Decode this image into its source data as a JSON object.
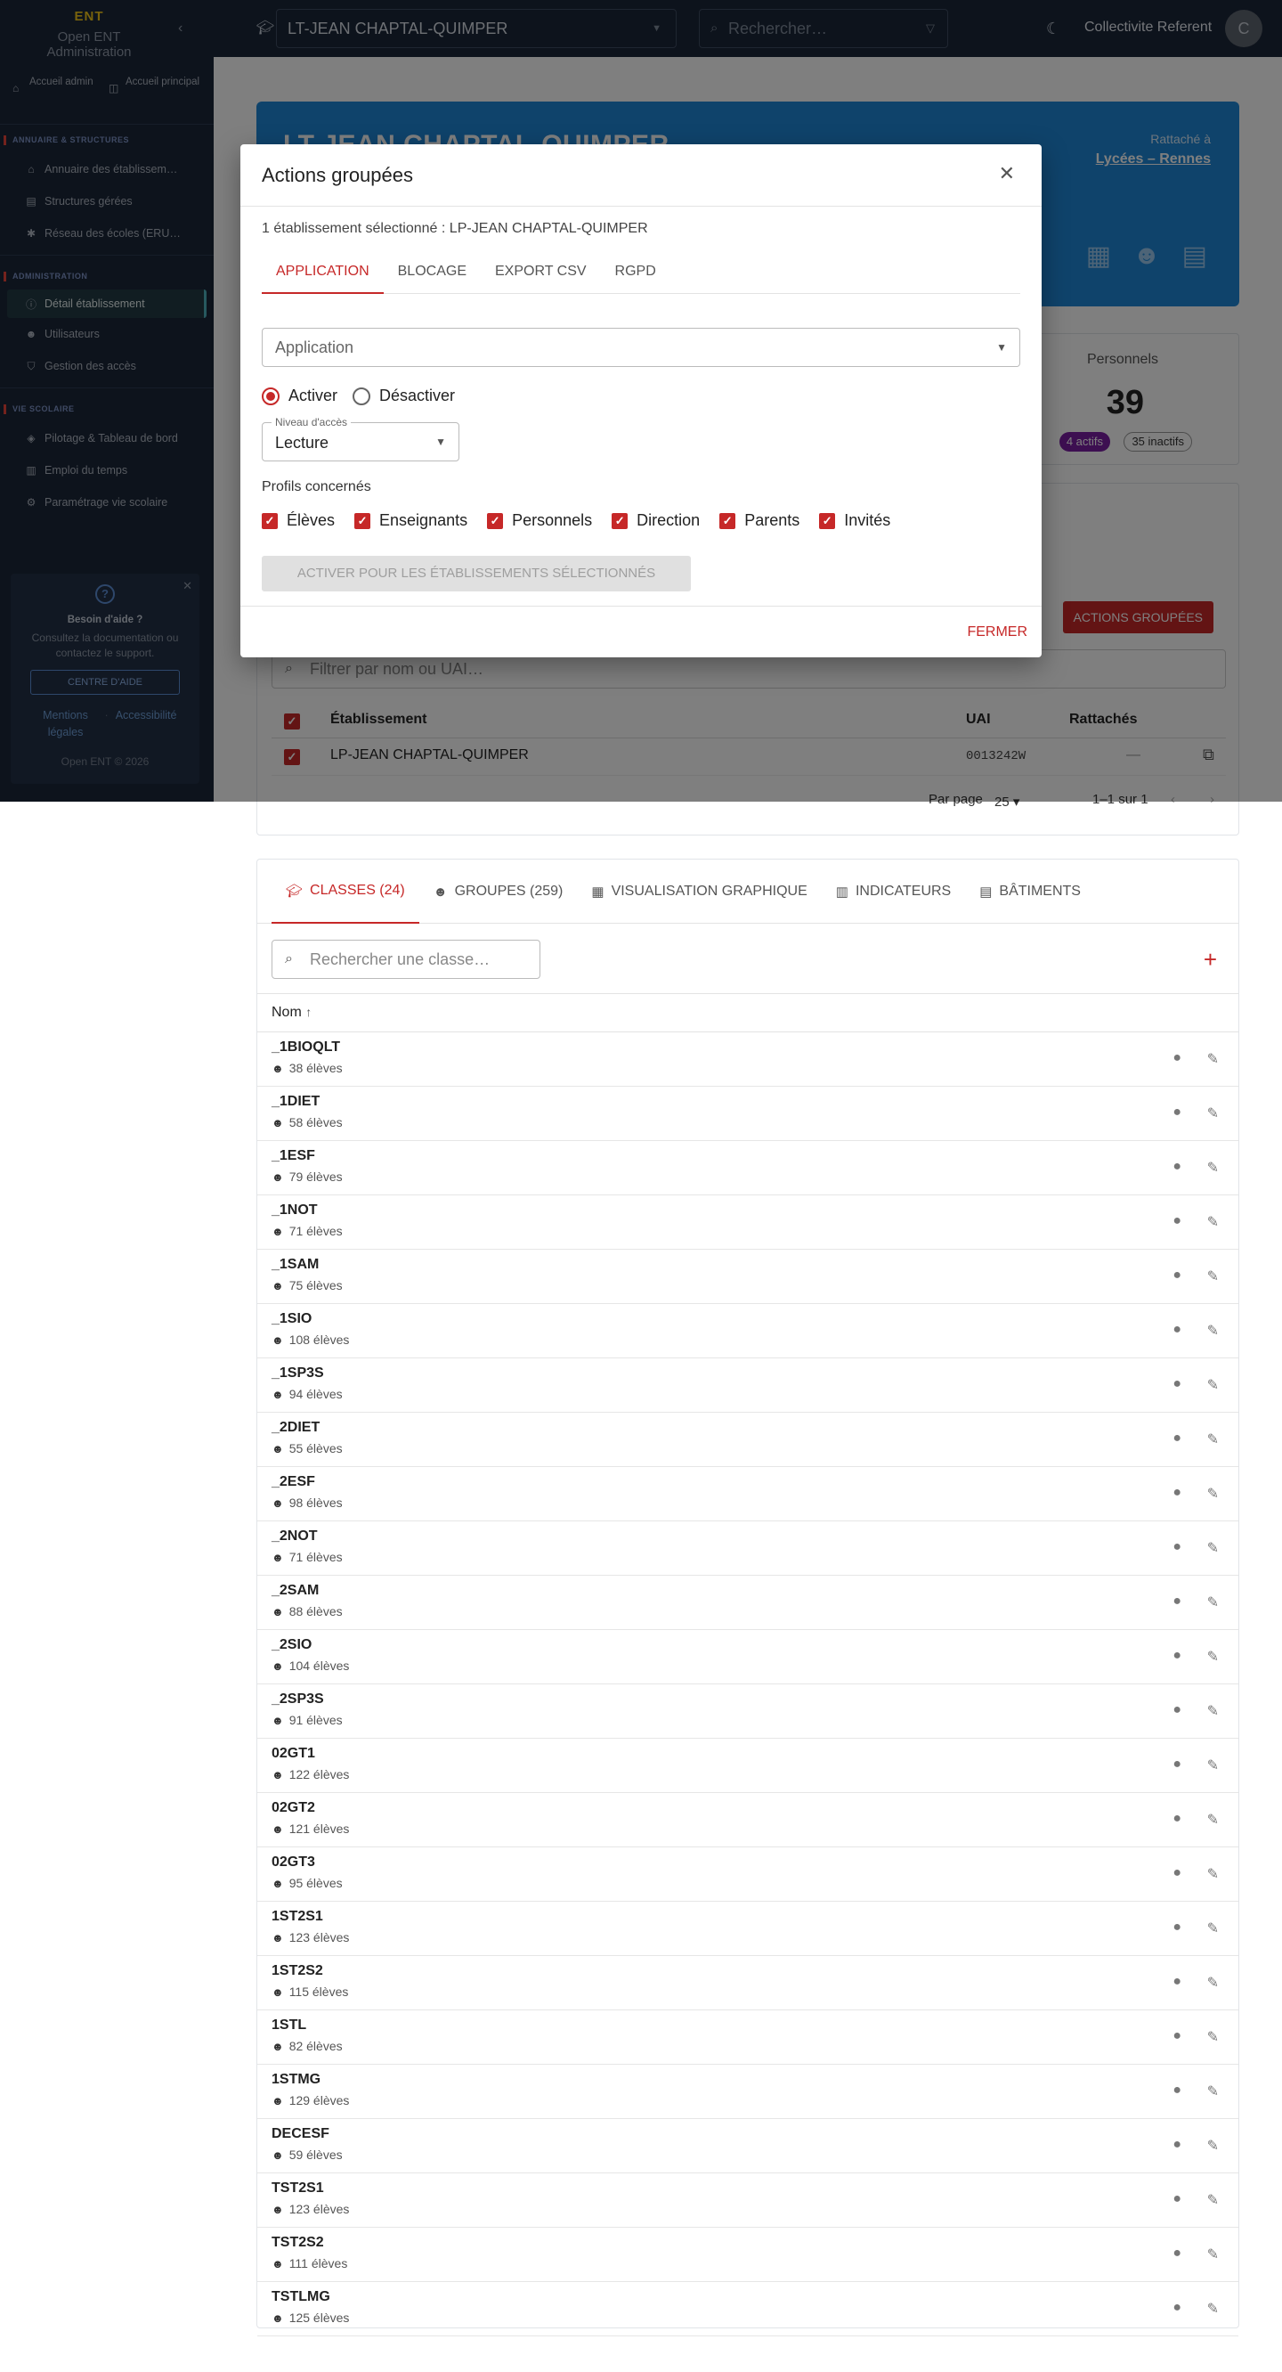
{
  "app": {
    "logo": "ENT",
    "name": "Open ENT Administration"
  },
  "sidebar": {
    "home": [
      {
        "label": "Accueil admin",
        "icon": "home-icon"
      },
      {
        "label": "Accueil principal",
        "icon": "external-link-icon"
      }
    ],
    "sections": [
      {
        "title": "Annuaire & structures",
        "items": [
          {
            "label": "Annuaire des établissem…",
            "icon": "building-icon"
          },
          {
            "label": "Structures gérées",
            "icon": "table-icon"
          },
          {
            "label": "Réseau des écoles (ERU…",
            "icon": "network-icon"
          }
        ]
      },
      {
        "title": "Administration",
        "items": [
          {
            "label": "Détail établissement",
            "icon": "info-icon",
            "active": true
          },
          {
            "label": "Utilisateurs",
            "icon": "users-icon"
          },
          {
            "label": "Gestion des accès",
            "icon": "shield-icon"
          }
        ]
      },
      {
        "title": "Vie scolaire",
        "items": [
          {
            "label": "Pilotage & Tableau de bord",
            "icon": "dashboard-icon"
          },
          {
            "label": "Emploi du temps",
            "icon": "calendar-icon"
          },
          {
            "label": "Paramétrage vie scolaire",
            "icon": "gear-icon"
          }
        ]
      }
    ],
    "help": {
      "title": "Besoin d'aide ?",
      "text": "Consultez la documentation ou contactez le support.",
      "button": "CENTRE D'AIDE",
      "link_legal": "Mentions légales",
      "link_access": "Accessibilité",
      "copyright": "Open ENT © 2026"
    }
  },
  "topbar": {
    "school": "LT-JEAN CHAPTAL-QUIMPER",
    "search_placeholder": "Rechercher…",
    "user": "Collectivite Referent",
    "avatar": "C"
  },
  "hero": {
    "title": "LT-JEAN CHAPTAL-QUIMPER",
    "attached_label": "Rattaché à",
    "attached_link": "Lycées – Rennes"
  },
  "stats": {
    "label": "Personnels",
    "value": "39",
    "active": "4 actifs",
    "inactive": "35 inactifs"
  },
  "etab_table": {
    "button": "ACTIONS GROUPÉES",
    "filter_placeholder": "Filtrer par nom ou UAI…",
    "headers": {
      "name": "Établissement",
      "uai": "UAI",
      "attached": "Rattachés"
    },
    "row": {
      "name": "LP-JEAN CHAPTAL-QUIMPER",
      "uai": "0013242W",
      "attached": "—"
    },
    "pager": {
      "per_page_label": "Par page",
      "per_page": "25",
      "range": "1–1 sur 1"
    }
  },
  "modal": {
    "title": "Actions groupées",
    "selection": "1 établissement sélectionné : LP-JEAN CHAPTAL-QUIMPER",
    "tabs": [
      "APPLICATION",
      "BLOCAGE",
      "EXPORT CSV",
      "RGPD"
    ],
    "application_placeholder": "Application",
    "radio_activate": "Activer",
    "radio_deactivate": "Désactiver",
    "level_label": "Niveau d'accès",
    "level_value": "Lecture",
    "profiles_label": "Profils concernés",
    "profiles": [
      "Élèves",
      "Enseignants",
      "Personnels",
      "Direction",
      "Parents",
      "Invités"
    ],
    "activate_button": "Activer pour les établissements sélectionnés",
    "close": "FERMER"
  },
  "classes_card": {
    "tabs": [
      {
        "label": "CLASSES (24)",
        "icon": "school-icon"
      },
      {
        "label": "GROUPES (259)",
        "icon": "groups-icon"
      },
      {
        "label": "VISUALISATION GRAPHIQUE",
        "icon": "graph-icon"
      },
      {
        "label": "INDICATEURS",
        "icon": "bar-chart-icon"
      },
      {
        "label": "BÂTIMENTS",
        "icon": "map-icon"
      }
    ],
    "search_placeholder": "Rechercher une classe…",
    "column_name": "Nom",
    "rows": [
      {
        "name": "_1BIOQLT",
        "count": "38 élèves"
      },
      {
        "name": "_1DIET",
        "count": "58 élèves"
      },
      {
        "name": "_1ESF",
        "count": "79 élèves"
      },
      {
        "name": "_1NOT",
        "count": "71 élèves"
      },
      {
        "name": "_1SAM",
        "count": "75 élèves"
      },
      {
        "name": "_1SIO",
        "count": "108 élèves"
      },
      {
        "name": "_1SP3S",
        "count": "94 élèves"
      },
      {
        "name": "_2DIET",
        "count": "55 élèves"
      },
      {
        "name": "_2ESF",
        "count": "98 élèves"
      },
      {
        "name": "_2NOT",
        "count": "71 élèves"
      },
      {
        "name": "_2SAM",
        "count": "88 élèves"
      },
      {
        "name": "_2SIO",
        "count": "104 élèves"
      },
      {
        "name": "_2SP3S",
        "count": "91 élèves"
      },
      {
        "name": "02GT1",
        "count": "122 élèves"
      },
      {
        "name": "02GT2",
        "count": "121 élèves"
      },
      {
        "name": "02GT3",
        "count": "95 élèves"
      },
      {
        "name": "1ST2S1",
        "count": "123 élèves"
      },
      {
        "name": "1ST2S2",
        "count": "115 élèves"
      },
      {
        "name": "1STL",
        "count": "82 élèves"
      },
      {
        "name": "1STMG",
        "count": "129 élèves"
      },
      {
        "name": "DECESF",
        "count": "59 élèves"
      },
      {
        "name": "TST2S1",
        "count": "123 élèves"
      },
      {
        "name": "TST2S2",
        "count": "111 élèves"
      },
      {
        "name": "TSTLMG",
        "count": "125 élèves"
      }
    ]
  },
  "colors": {
    "accent": "#c62828",
    "sidebar": "#1b2638",
    "hero": "#1f87d6"
  }
}
